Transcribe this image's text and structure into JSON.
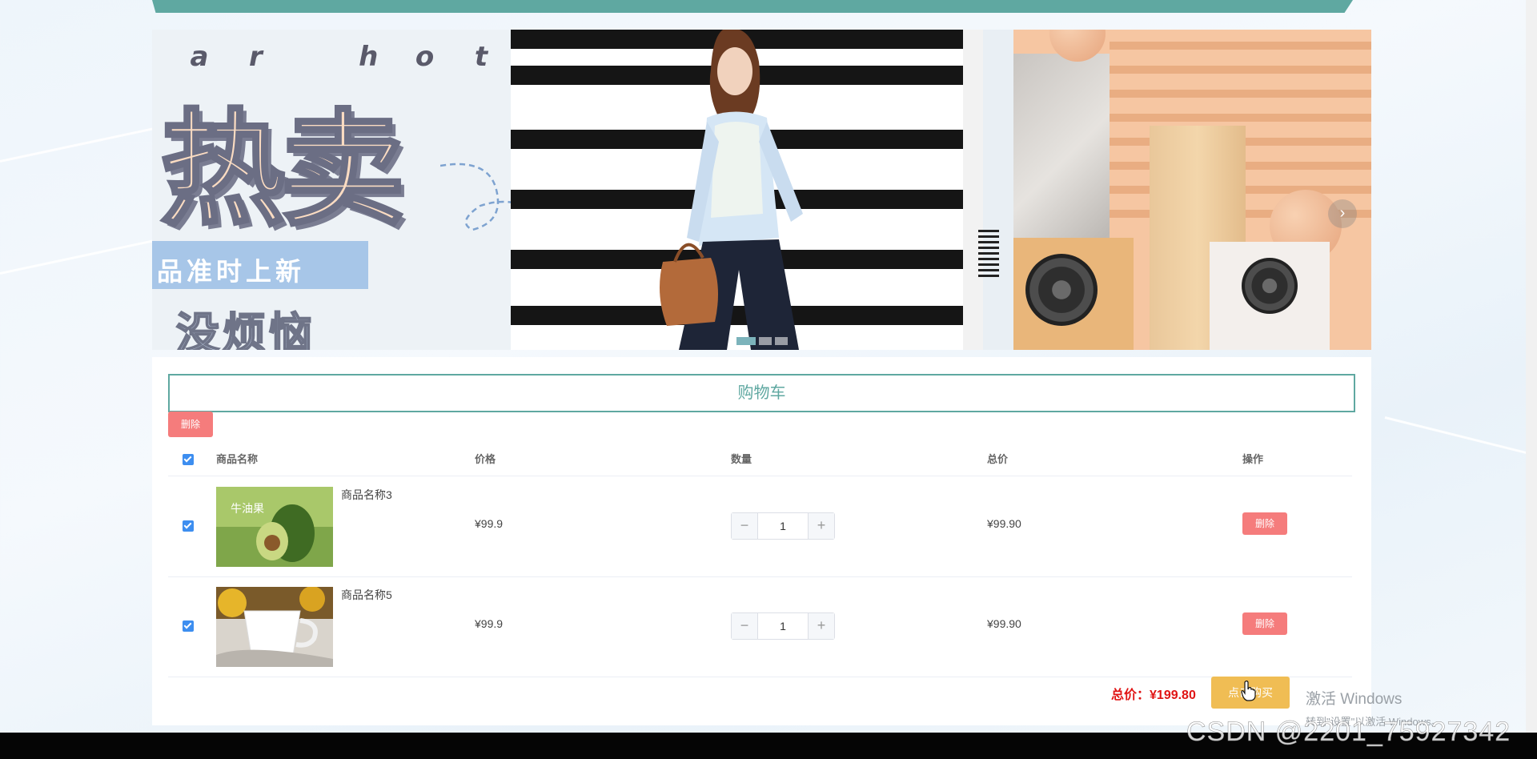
{
  "banner": {
    "letters": [
      "a",
      "r",
      "h",
      "o",
      "t"
    ],
    "headline": "热卖",
    "tagline_1": "品准时上新",
    "tagline_2": "没烦恼",
    "next_arrow": "›",
    "active_slide": 1,
    "slide_count": 3
  },
  "cart": {
    "title": "购物车",
    "delete_selected_label": "删除",
    "columns": [
      "商品名称",
      "价格",
      "数量",
      "总价",
      "操作"
    ],
    "items": [
      {
        "name": "商品名称3",
        "price": "¥99.9",
        "quantity": "1",
        "total": "¥99.90",
        "delete_label": "删除",
        "thumb_text": "牛油果"
      },
      {
        "name": "商品名称5",
        "price": "¥99.9",
        "quantity": "1",
        "total": "¥99.90",
        "delete_label": "删除"
      }
    ],
    "grand_total_label": "总价：",
    "grand_total_value": "¥199.80",
    "buy_label": "点击购买"
  },
  "stepper": {
    "minus": "−",
    "plus": "+"
  },
  "os_overlay": {
    "activate_title": "激活 Windows",
    "activate_hint": "转到\"设置\"以激活 Windows。",
    "watermark": "CSDN @2201_75927342"
  },
  "colors": {
    "accent": "#5fa8a1",
    "danger": "#f57c7c",
    "buy": "#f0bd54",
    "total": "#e01414",
    "checkbox": "#3d8ef0"
  }
}
